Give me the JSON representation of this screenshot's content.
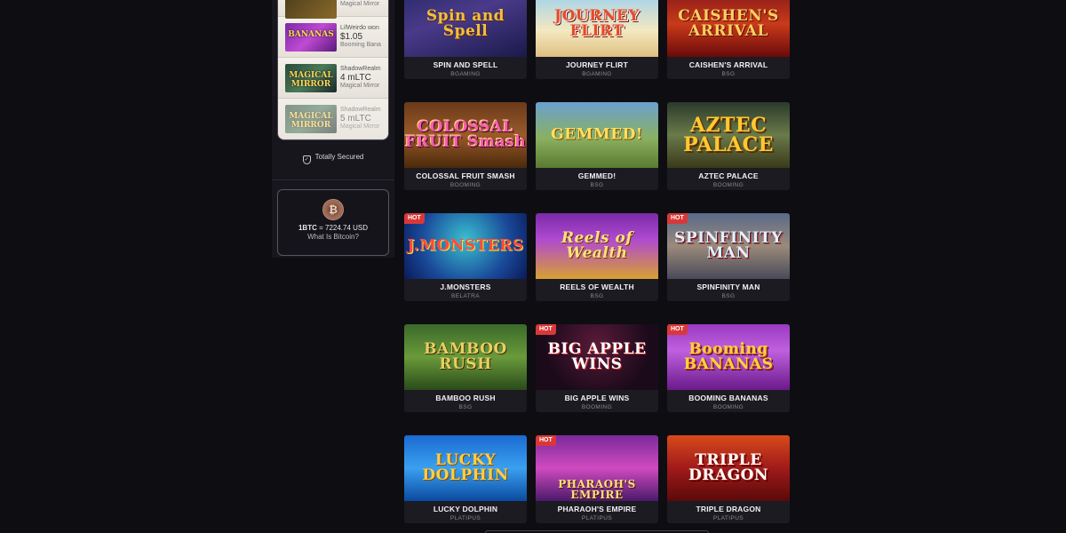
{
  "sidebar": {
    "recent_wins": [
      {
        "user": "",
        "amount": "",
        "game": "Magical Mirror",
        "thumb": "partial",
        "thumb_text": ""
      },
      {
        "user": "LilWeirdo won",
        "amount": "$1.05",
        "game": "Booming Bana",
        "thumb": "bananas",
        "thumb_text": "BANANAS"
      },
      {
        "user": "ShadowRealm",
        "amount": "4 mLTC",
        "game": "Magical Mirror",
        "thumb": "mirror",
        "thumb_text": "MAGICAL MIRROR"
      },
      {
        "user": "ShadowRealm",
        "amount": "5 mLTC",
        "game": "Magical Mirror",
        "thumb": "mirror",
        "thumb_text": "MAGICAL MIRROR"
      }
    ],
    "secured_label": "Totally Secured",
    "btc": {
      "coin_symbol": "₿",
      "rate_prefix": "1BTC",
      "rate_value": "= 7224.74 USD",
      "link": "What Is Bitcoin?"
    }
  },
  "games": [
    {
      "name": "SPIN AND SPELL",
      "provider": "BGAMING",
      "hot": false,
      "logo": "Spin and Spell",
      "bg": "spin"
    },
    {
      "name": "JOURNEY FLIRT",
      "provider": "BGAMING",
      "hot": false,
      "logo": "JOURNEY FLIRT",
      "bg": "journey"
    },
    {
      "name": "CAISHEN'S ARRIVAL",
      "provider": "BSG",
      "hot": false,
      "logo": "CAISHEN'S ARRIVAL",
      "bg": "caishen"
    },
    {
      "name": "COLOSSAL FRUIT SMASH",
      "provider": "BOOMING",
      "hot": false,
      "logo": "COLOSSAL FRUIT Smash",
      "bg": "colossal"
    },
    {
      "name": "GEMMED!",
      "provider": "BSG",
      "hot": false,
      "logo": "GEMMED!",
      "bg": "gemmed"
    },
    {
      "name": "AZTEC PALACE",
      "provider": "BOOMING",
      "hot": false,
      "logo": "AZTEC PALACE",
      "bg": "aztec"
    },
    {
      "name": "J.MONSTERS",
      "provider": "BELATRA",
      "hot": true,
      "logo": "J.MONSTERS",
      "bg": "monsters"
    },
    {
      "name": "REELS OF WEALTH",
      "provider": "BSG",
      "hot": false,
      "logo": "Reels of Wealth",
      "bg": "reels"
    },
    {
      "name": "SPINFINITY MAN",
      "provider": "BSG",
      "hot": true,
      "logo": "SPINFINITY MAN",
      "bg": "spinfinity"
    },
    {
      "name": "BAMBOO RUSH",
      "provider": "BSG",
      "hot": false,
      "logo": "BAMBOO RUSH",
      "bg": "bamboo"
    },
    {
      "name": "BIG APPLE WINS",
      "provider": "BOOMING",
      "hot": true,
      "logo": "BIG APPLE WINS",
      "bg": "bigapple"
    },
    {
      "name": "BOOMING BANANAS",
      "provider": "BOOMING",
      "hot": true,
      "logo": "Booming BANANAS",
      "bg": "bananas"
    },
    {
      "name": "LUCKY DOLPHIN",
      "provider": "PLATIPUS",
      "hot": false,
      "logo": "LUCKY DOLPHIN",
      "bg": "dolphin"
    },
    {
      "name": "PHARAOH'S EMPIRE",
      "provider": "PLATIPUS",
      "hot": true,
      "logo": "PHARAOH'S EMPIRE",
      "bg": "pharaoh"
    },
    {
      "name": "TRIPLE DRAGON",
      "provider": "PLATIPUS",
      "hot": false,
      "logo": "TRIPLE DRAGON",
      "bg": "dragon"
    }
  ],
  "hot_label": "HOT"
}
